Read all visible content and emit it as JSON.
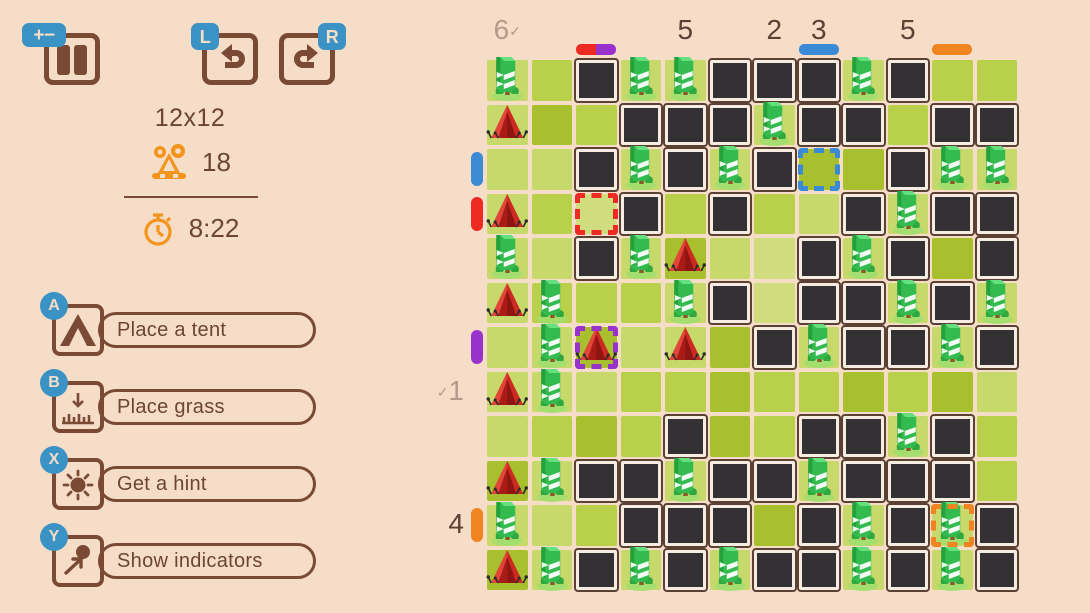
{
  "theme": {
    "background": "#f6ddc8",
    "ink": "#6b4436",
    "ink_dark": "#5b4034",
    "ink_muted": "#b49a8c",
    "badge_blue": "#3a93c4",
    "accent_orange": "#f3941c",
    "grass_light": "#cfdd7e",
    "grass_mid": "#b9d04a",
    "grass_dark": "#a8bf2e",
    "dark_cell": "#333133",
    "tent_red": "#cc2a22",
    "tree_green": "#3ec25a"
  },
  "toolbar": {
    "pause": {
      "label": "pause",
      "badge": "+−",
      "name": "pause-button"
    },
    "undo": {
      "label": "undo",
      "badge": "L",
      "name": "undo-button"
    },
    "redo": {
      "label": "redo",
      "badge": "R",
      "name": "redo-button"
    }
  },
  "stats": {
    "size": "12x12",
    "score_icon": "puzzle-gears-icon",
    "score": "18",
    "timer_icon": "stopwatch-icon",
    "timer": "8:22"
  },
  "actions": [
    {
      "badge": "A",
      "label": "Place a tent",
      "icon": "tent-icon"
    },
    {
      "badge": "B",
      "label": "Place grass",
      "icon": "grass-icon"
    },
    {
      "badge": "X",
      "label": "Get a hint",
      "icon": "lightbulb-icon"
    },
    {
      "badge": "Y",
      "label": "Show indicators",
      "icon": "indicator-arrow-icon"
    }
  ],
  "board": {
    "size": 12,
    "col_headers": [
      "6",
      "",
      "",
      "",
      "5",
      "",
      "2",
      "3",
      "",
      "5",
      "",
      ""
    ],
    "col_headers_done": [
      true,
      false,
      false,
      false,
      false,
      false,
      false,
      false,
      false,
      false,
      false,
      false
    ],
    "row_headers": [
      "",
      "",
      "",
      "",
      "",
      "",
      "",
      "1",
      "",
      "",
      "4",
      ""
    ],
    "row_headers_done": [
      false,
      false,
      false,
      false,
      false,
      false,
      false,
      true,
      false,
      false,
      false,
      false
    ],
    "col_markers": [
      {
        "col": 2,
        "colors": [
          "#ee2a23",
          "#9932cc"
        ]
      },
      {
        "col": 7,
        "colors": [
          "#3a8ad6"
        ]
      },
      {
        "col": 10,
        "colors": [
          "#f08420"
        ]
      }
    ],
    "row_markers": [
      {
        "row": 2,
        "color": "#3a8ad6"
      },
      {
        "row": 3,
        "color": "#ee2a23"
      },
      {
        "row": 6,
        "color": "#9932cc"
      },
      {
        "row": 10,
        "color": "#f08420"
      }
    ],
    "selections": [
      {
        "row": 3,
        "col": 2,
        "color": "red"
      },
      {
        "row": 2,
        "col": 7,
        "color": "blue"
      },
      {
        "row": 6,
        "col": 2,
        "color": "purple"
      },
      {
        "row": 10,
        "col": 10,
        "color": "orange"
      }
    ],
    "legend": {
      "E": "empty grass",
      "D": "dark/grass-marked cell",
      "T": "tree",
      "C": "tent"
    },
    "cells": [
      [
        "T",
        "E",
        "D",
        "T",
        "T",
        "D",
        "D",
        "D",
        "T",
        "D",
        "E",
        "E"
      ],
      [
        "C",
        "E",
        "E",
        "D",
        "D",
        "D",
        "T",
        "D",
        "D",
        "E",
        "D",
        "D"
      ],
      [
        "E",
        "E",
        "D",
        "T",
        "D",
        "T",
        "D",
        "E",
        "E",
        "D",
        "T",
        "T"
      ],
      [
        "C",
        "E",
        "E",
        "D",
        "E",
        "D",
        "E",
        "E",
        "D",
        "T",
        "D",
        "D"
      ],
      [
        "T",
        "E",
        "D",
        "T",
        "C",
        "E",
        "E",
        "D",
        "T",
        "D",
        "E",
        "D"
      ],
      [
        "C",
        "T",
        "E",
        "E",
        "T",
        "D",
        "E",
        "D",
        "D",
        "T",
        "D",
        "T"
      ],
      [
        "E",
        "T",
        "C",
        "E",
        "C",
        "E",
        "D",
        "T",
        "D",
        "D",
        "T",
        "D"
      ],
      [
        "C",
        "T",
        "E",
        "E",
        "E",
        "E",
        "E",
        "E",
        "E",
        "E",
        "E",
        "E"
      ],
      [
        "E",
        "E",
        "E",
        "E",
        "D",
        "E",
        "E",
        "D",
        "D",
        "T",
        "D",
        "E"
      ],
      [
        "C",
        "T",
        "D",
        "D",
        "T",
        "D",
        "D",
        "T",
        "D",
        "D",
        "D",
        "E"
      ],
      [
        "T",
        "E",
        "E",
        "D",
        "D",
        "D",
        "E",
        "D",
        "T",
        "D",
        "T",
        "D"
      ],
      [
        "C",
        "T",
        "D",
        "T",
        "D",
        "T",
        "D",
        "D",
        "T",
        "D",
        "T",
        "D"
      ]
    ],
    "shade": [
      [
        1,
        2,
        0,
        1,
        1,
        0,
        0,
        0,
        1,
        0,
        2,
        2
      ],
      [
        1,
        3,
        2,
        0,
        0,
        0,
        1,
        0,
        0,
        2,
        0,
        0
      ],
      [
        1,
        1,
        0,
        1,
        0,
        1,
        0,
        3,
        3,
        0,
        1,
        1
      ],
      [
        1,
        2,
        0,
        0,
        2,
        0,
        2,
        1,
        0,
        1,
        0,
        0
      ],
      [
        1,
        1,
        0,
        1,
        3,
        1,
        0,
        0,
        1,
        0,
        3,
        0
      ],
      [
        1,
        2,
        2,
        2,
        1,
        0,
        0,
        0,
        0,
        1,
        0,
        1
      ],
      [
        1,
        1,
        3,
        1,
        1,
        3,
        0,
        1,
        0,
        0,
        1,
        0
      ],
      [
        1,
        1,
        1,
        2,
        2,
        3,
        2,
        2,
        3,
        2,
        3,
        1
      ],
      [
        1,
        2,
        3,
        2,
        0,
        3,
        2,
        0,
        0,
        1,
        0,
        2
      ],
      [
        3,
        1,
        0,
        0,
        1,
        0,
        0,
        1,
        0,
        0,
        0,
        2
      ],
      [
        1,
        1,
        2,
        0,
        0,
        0,
        3,
        0,
        1,
        0,
        1,
        0
      ],
      [
        3,
        1,
        0,
        1,
        0,
        1,
        0,
        0,
        1,
        0,
        1,
        0
      ]
    ]
  }
}
